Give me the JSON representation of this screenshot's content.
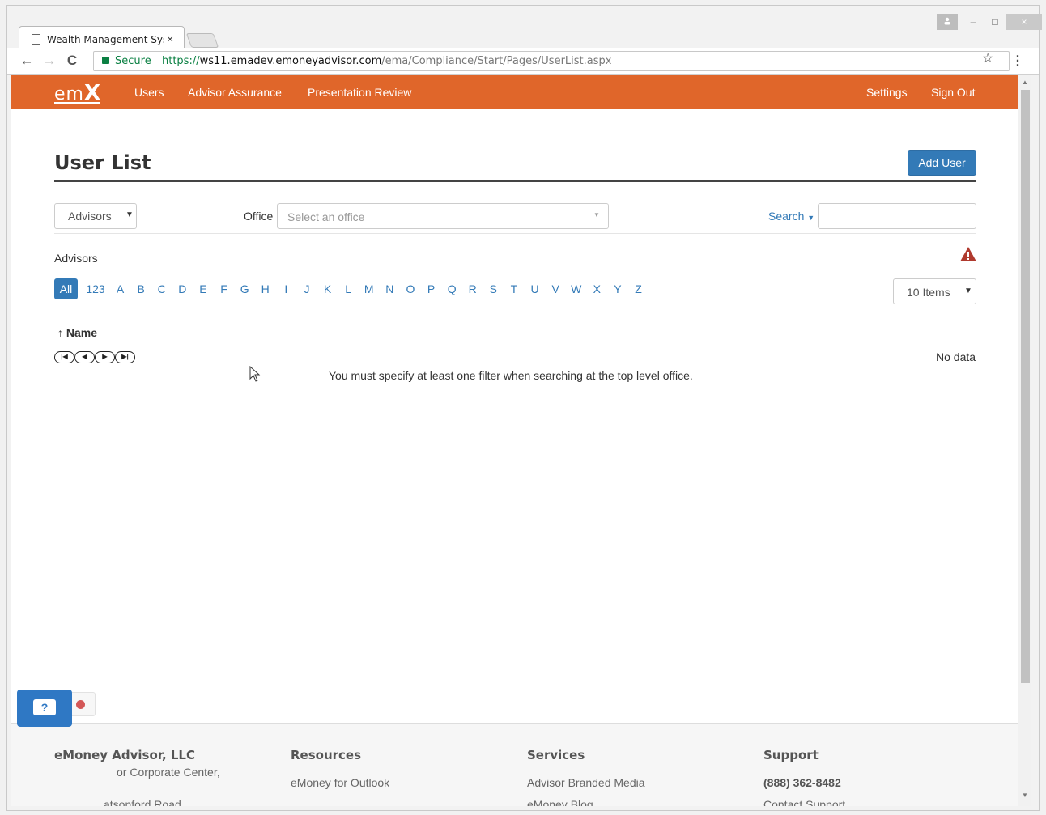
{
  "browser": {
    "tab_title": "Wealth Management Sys",
    "tab_close": "×",
    "secure_label": "Secure",
    "url_scheme": "https://",
    "url_host": "ws11.emadev.emoneyadvisor.com",
    "url_path": "/ema/Compliance/Start/Pages/UserList.aspx",
    "back_glyph": "←",
    "forward_glyph": "→",
    "reload_glyph": "C",
    "star_glyph": "☆",
    "menu_glyph": "⋮",
    "min_glyph": "–",
    "max_glyph": "□",
    "close_glyph": "×"
  },
  "nav": {
    "logo_em": "em",
    "logo_x": "X",
    "links": [
      "Users",
      "Advisor Assurance",
      "Presentation Review"
    ],
    "settings": "Settings",
    "sign_out": "Sign Out"
  },
  "page": {
    "title": "User List",
    "add_user": "Add User"
  },
  "filters": {
    "user_type": "Advisors",
    "office_label": "Office",
    "office_placeholder": "Select an office",
    "search_label": "Search",
    "search_value": ""
  },
  "list": {
    "section_label": "Advisors",
    "alpha": [
      "All",
      "123",
      "A",
      "B",
      "C",
      "D",
      "E",
      "F",
      "G",
      "H",
      "I",
      "J",
      "K",
      "L",
      "M",
      "N",
      "O",
      "P",
      "Q",
      "R",
      "S",
      "T",
      "U",
      "V",
      "W",
      "X",
      "Y",
      "Z"
    ],
    "active_alpha": "All",
    "page_size": "10 Items",
    "column_name": "Name",
    "sort_glyph": "↑",
    "no_data": "No data",
    "empty_message": "You must specify at least one filter when searching at the top level office."
  },
  "footer": {
    "company": "eMoney Advisor, LLC",
    "address_line1": "or Corporate Center,",
    "address_line2": "atsonford Road",
    "resources_head": "Resources",
    "resources_item1": "eMoney for Outlook",
    "services_head": "Services",
    "services_item1": "Advisor Branded Media",
    "services_item2": "eMoney Blog",
    "support_head": "Support",
    "support_phone": "(888) 362-8482",
    "support_item2": "Contact Support"
  },
  "colors": {
    "brand_orange": "#e0662a",
    "primary_blue": "#337ab7",
    "warning_red": "#b03a2e"
  }
}
